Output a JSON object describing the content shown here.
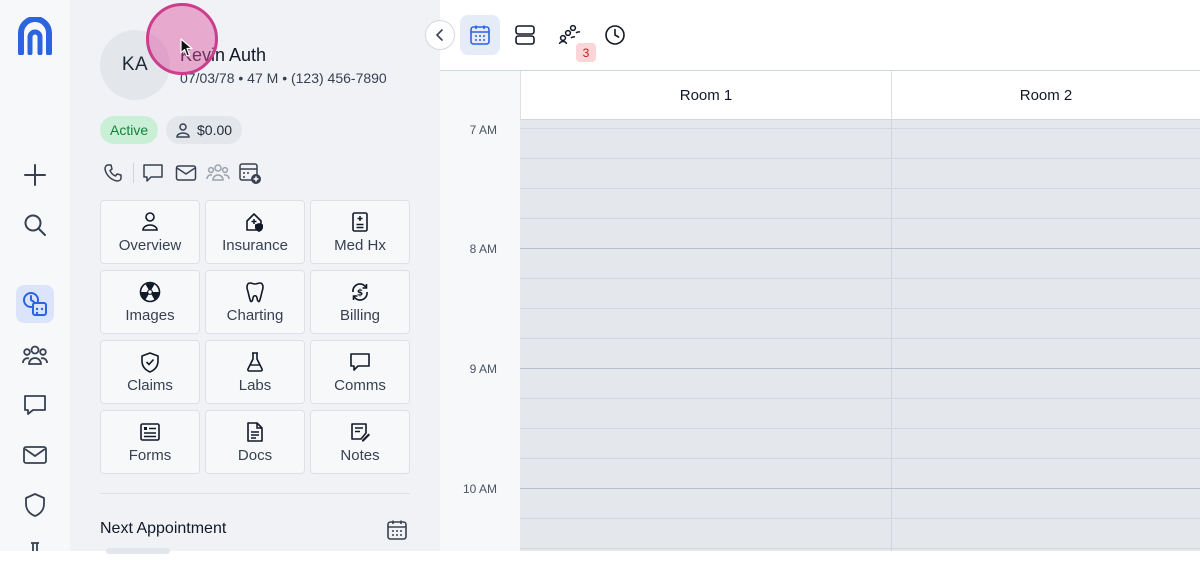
{
  "rail": {
    "items": [
      {
        "name": "add-icon"
      },
      {
        "name": "search-icon"
      },
      {
        "name": "schedule-icon",
        "active": true
      },
      {
        "name": "patients-icon"
      },
      {
        "name": "messages-icon"
      },
      {
        "name": "mail-icon"
      },
      {
        "name": "shield-icon"
      },
      {
        "name": "more-icon"
      }
    ]
  },
  "patient": {
    "initials": "KA",
    "name": "Kevin Auth",
    "meta": "07/03/78 • 47 M • (123) 456-7890",
    "status": "Active",
    "balance": "$0.00"
  },
  "contact_actions": [
    "phone-icon",
    "chat-icon",
    "email-icon",
    "family-icon",
    "schedule-add-icon"
  ],
  "tiles": [
    {
      "label": "Overview",
      "icon": "person-icon"
    },
    {
      "label": "Insurance",
      "icon": "insurance-icon"
    },
    {
      "label": "Med Hx",
      "icon": "medical-history-icon"
    },
    {
      "label": "Images",
      "icon": "radiation-icon"
    },
    {
      "label": "Charting",
      "icon": "tooth-icon"
    },
    {
      "label": "Billing",
      "icon": "billing-icon"
    },
    {
      "label": "Claims",
      "icon": "shield-check-icon"
    },
    {
      "label": "Labs",
      "icon": "flask-icon"
    },
    {
      "label": "Comms",
      "icon": "chat-icon"
    },
    {
      "label": "Forms",
      "icon": "form-icon"
    },
    {
      "label": "Docs",
      "icon": "document-icon"
    },
    {
      "label": "Notes",
      "icon": "note-icon"
    }
  ],
  "next_appointment": {
    "label": "Next Appointment"
  },
  "calendar": {
    "toolbar": {
      "views": [
        "calendar-view-icon",
        "rows-view-icon",
        "waitlist-icon",
        "history-icon"
      ],
      "active_view": "calendar-view-icon",
      "waitlist_count": "3"
    },
    "rooms": [
      "Room 1",
      "Room 2"
    ],
    "times": [
      "7 AM",
      "8 AM",
      "9 AM",
      "10 AM"
    ],
    "colors": {
      "accent": "#2b63e0",
      "slot_bg": "#e4e7ec",
      "active_badge": "#c9f0d6"
    }
  }
}
